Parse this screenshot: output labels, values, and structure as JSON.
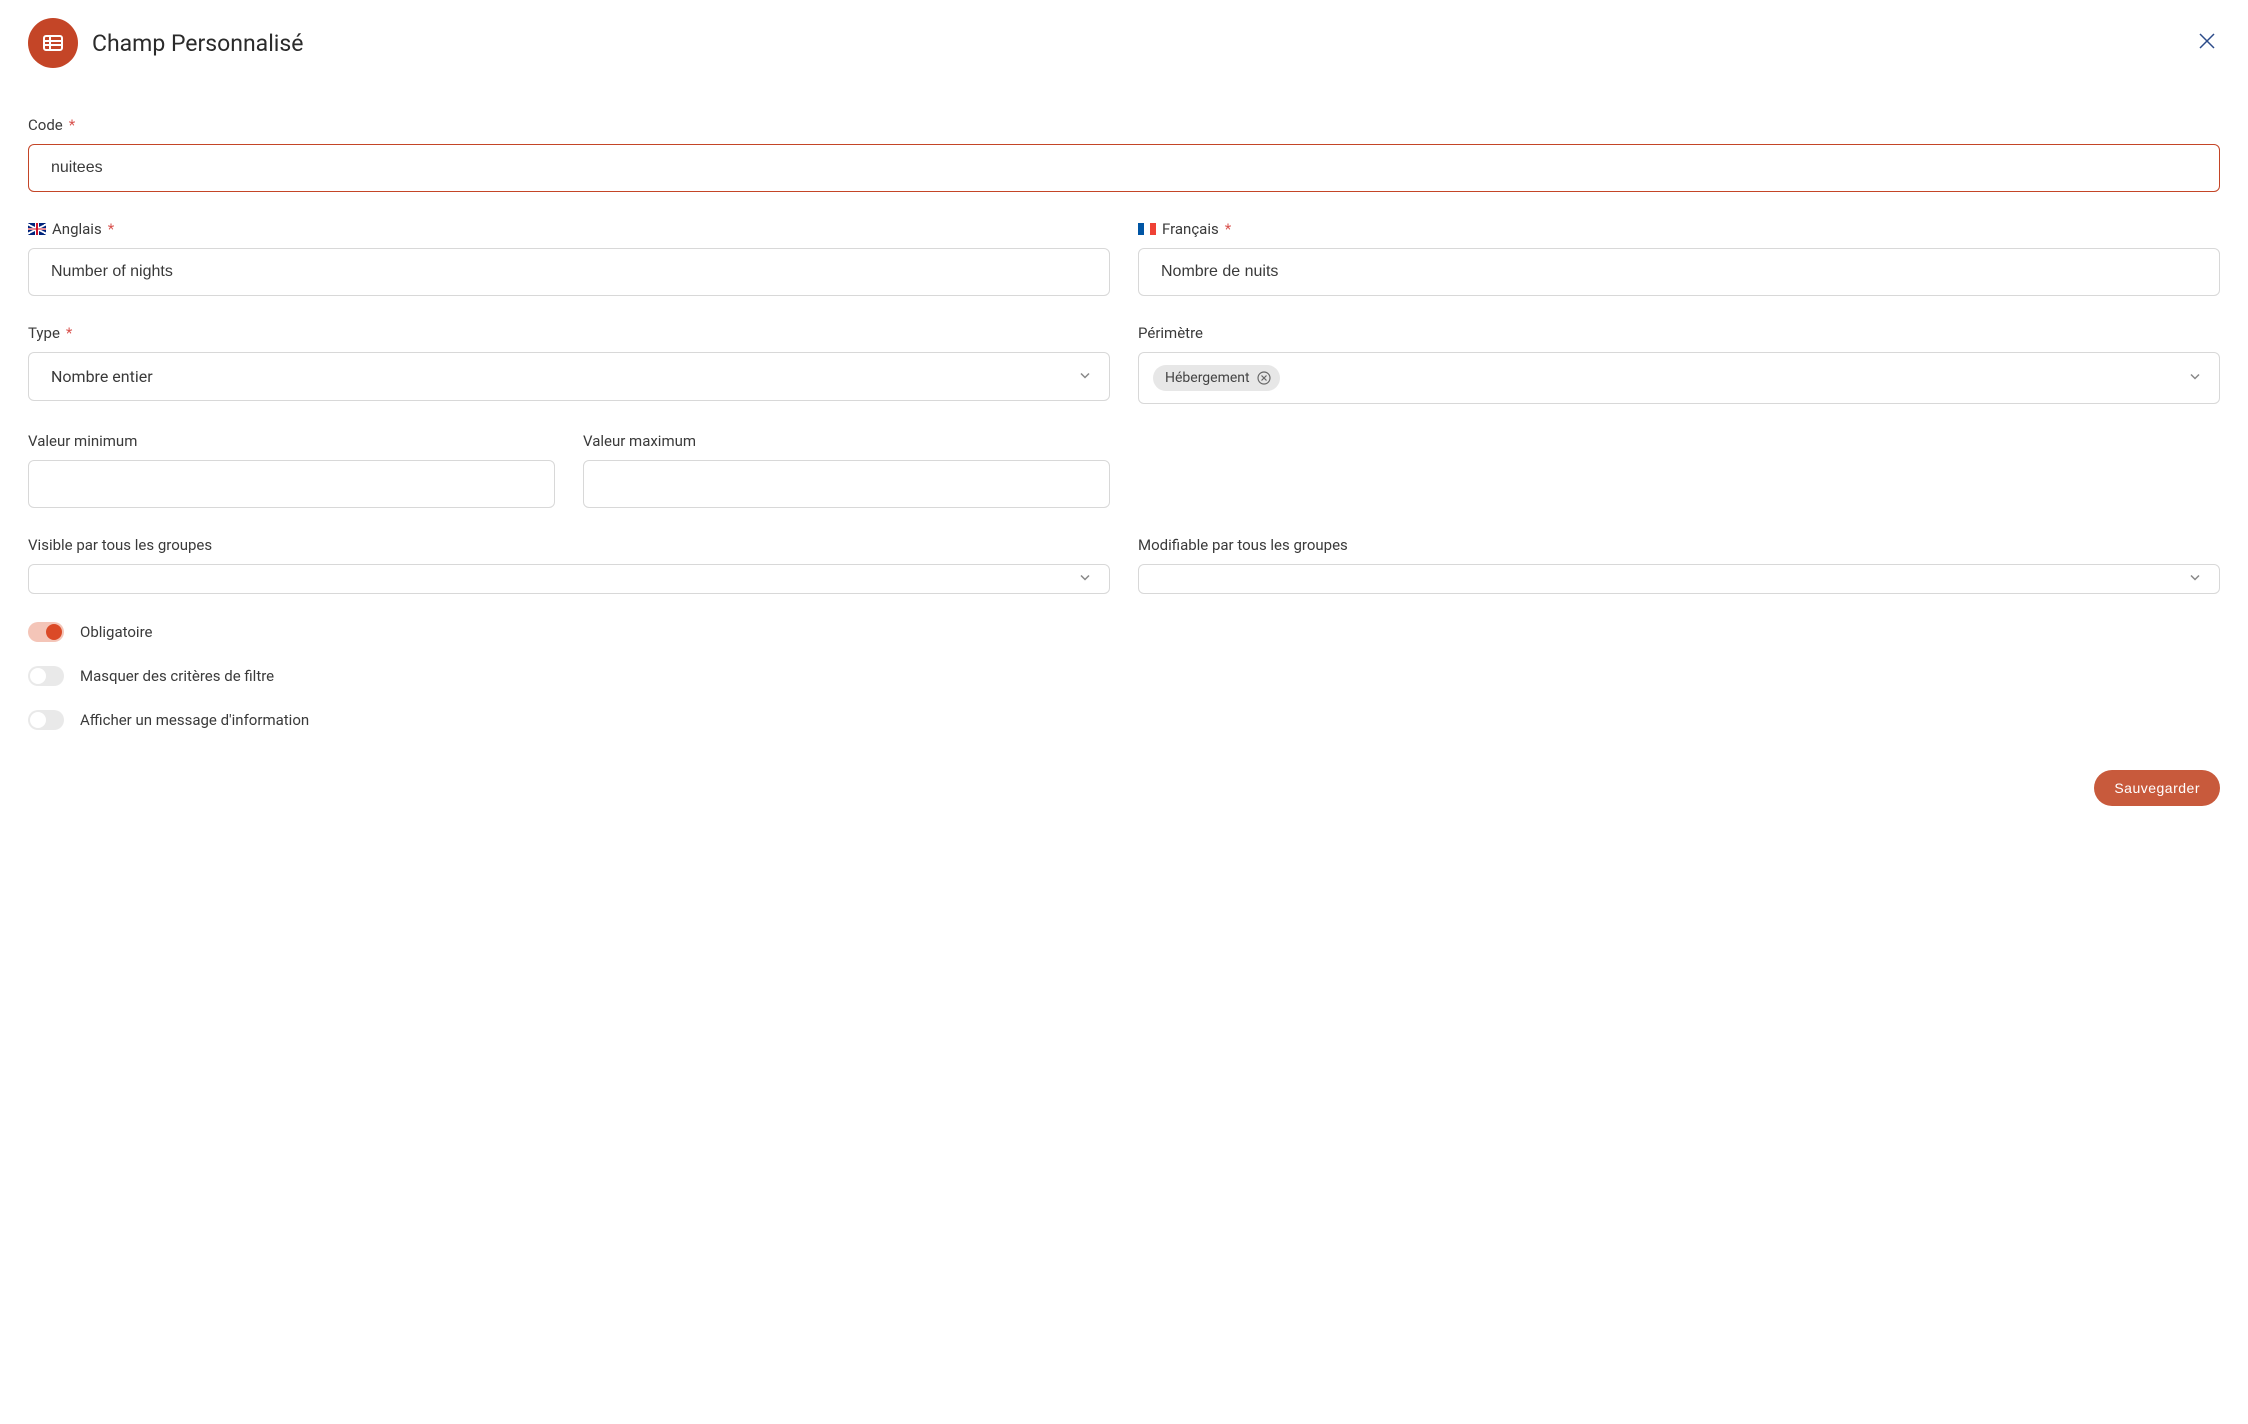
{
  "header": {
    "title": "Champ Personnalisé"
  },
  "labels": {
    "code": "Code",
    "english": "Anglais",
    "french": "Français",
    "type": "Type",
    "perimeter": "Périmètre",
    "min": "Valeur minimum",
    "max": "Valeur maximum",
    "visible_groups": "Visible par tous les groupes",
    "editable_groups": "Modifiable par tous les groupes"
  },
  "values": {
    "code": "nuitees",
    "english": "Number of nights",
    "french": "Nombre de nuits",
    "type": "Nombre entier",
    "perimeter_tag": "Hébergement",
    "min": "",
    "max": "",
    "visible_groups": "",
    "editable_groups": ""
  },
  "toggles": {
    "required": {
      "label": "Obligatoire",
      "on": true
    },
    "hide_filter": {
      "label": "Masquer des critères de filtre",
      "on": false
    },
    "info_msg": {
      "label": "Afficher un message d'information",
      "on": false
    }
  },
  "footer": {
    "save": "Sauvegarder"
  }
}
